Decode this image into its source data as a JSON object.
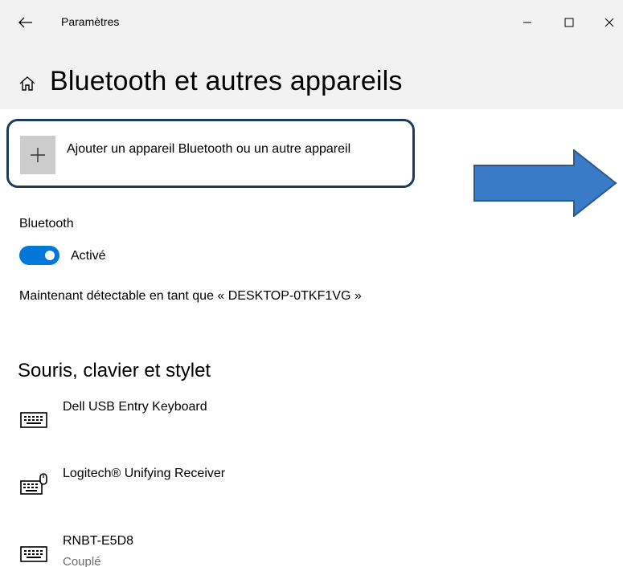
{
  "titlebar": {
    "app_title": "Paramètres",
    "icons": {
      "back": "back-arrow-icon",
      "minimize": "minimize-icon",
      "maximize": "maximize-icon",
      "close": "close-icon"
    }
  },
  "page": {
    "title": "Bluetooth et autres appareils",
    "home_icon": "home-icon"
  },
  "add_device": {
    "label": "Ajouter un appareil Bluetooth ou un autre appareil",
    "icon": "plus-icon"
  },
  "bluetooth": {
    "label": "Bluetooth",
    "toggle_state": "Activé",
    "toggle_on": true,
    "discoverable_text": "Maintenant détectable en tant que « DESKTOP-0TKF1VG »"
  },
  "section": {
    "title": "Souris, clavier et stylet",
    "devices": [
      {
        "name": "Dell USB Entry Keyboard",
        "status": "",
        "icon": "keyboard-icon"
      },
      {
        "name": "Logitech® Unifying Receiver",
        "status": "",
        "icon": "keyboard-mouse-icon"
      },
      {
        "name": "RNBT-E5D8",
        "status": "Couplé",
        "icon": "keyboard-icon"
      }
    ]
  },
  "colors": {
    "accent": "#0078d7",
    "header_bg": "#f2f2f2",
    "highlight_border": "#1f3b5c",
    "arrow_fill": "#3a7bc8",
    "arrow_stroke": "#2a5a8c",
    "plus_box_bg": "#cccccc",
    "secondary_text": "#6b6b6b"
  }
}
